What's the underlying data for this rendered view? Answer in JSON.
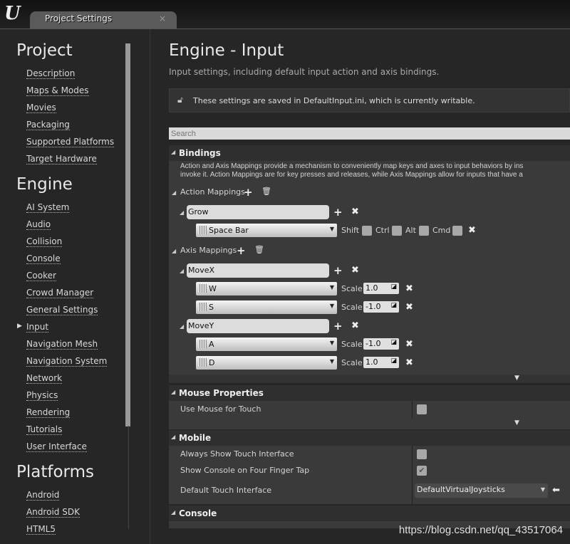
{
  "window": {
    "tab_title": "Project Settings",
    "logo": "U",
    "close": "×"
  },
  "sidebar": {
    "sections": [
      {
        "title": "Project",
        "items": [
          "Description",
          "Maps & Modes",
          "Movies",
          "Packaging",
          "Supported Platforms",
          "Target Hardware"
        ]
      },
      {
        "title": "Engine",
        "items": [
          "AI System",
          "Audio",
          "Collision",
          "Console",
          "Cooker",
          "Crowd Manager",
          "General Settings",
          "Input",
          "Navigation Mesh",
          "Navigation System",
          "Network",
          "Physics",
          "Rendering",
          "Tutorials",
          "User Interface"
        ]
      },
      {
        "title": "Platforms",
        "items": [
          "Android",
          "Android SDK",
          "HTML5"
        ]
      }
    ],
    "selected": "Input"
  },
  "main": {
    "title": "Engine - Input",
    "subtitle": "Input settings, including default input action and axis bindings.",
    "notice": "These settings are saved in DefaultInput.ini, which is currently writable.",
    "search_placeholder": "Search",
    "bindings": {
      "header": "Bindings",
      "desc1": "Action and Axis Mappings provide a mechanism to conveniently map keys and axes to input behaviors by ins",
      "desc2": "invoke it. Action Mappings are for key presses and releases, while Axis Mappings allow for inputs that have a",
      "action_label": "Action Mappings",
      "axis_label": "Axis Mappings",
      "actions": [
        {
          "name": "Grow",
          "key": "Space Bar",
          "modifiers": [
            "Shift",
            "Ctrl",
            "Alt",
            "Cmd"
          ]
        }
      ],
      "axes": [
        {
          "name": "MoveX",
          "keys": [
            {
              "key": "W",
              "scale": "1.0"
            },
            {
              "key": "S",
              "scale": "-1.0"
            }
          ]
        },
        {
          "name": "MoveY",
          "keys": [
            {
              "key": "A",
              "scale": "-1.0"
            },
            {
              "key": "D",
              "scale": "1.0"
            }
          ]
        }
      ],
      "scale_label": "Scale"
    },
    "mouse": {
      "header": "Mouse Properties",
      "use_mouse_for_touch": {
        "label": "Use Mouse for Touch",
        "checked": false
      }
    },
    "mobile": {
      "header": "Mobile",
      "always_show": {
        "label": "Always Show Touch Interface",
        "checked": false
      },
      "four_finger": {
        "label": "Show Console on Four Finger Tap",
        "checked": true
      },
      "default_touch": {
        "label": "Default Touch Interface",
        "value": "DefaultVirtualJoysticks"
      }
    },
    "console": {
      "header": "Console"
    }
  },
  "watermark": "https://blog.csdn.net/qq_43517064"
}
